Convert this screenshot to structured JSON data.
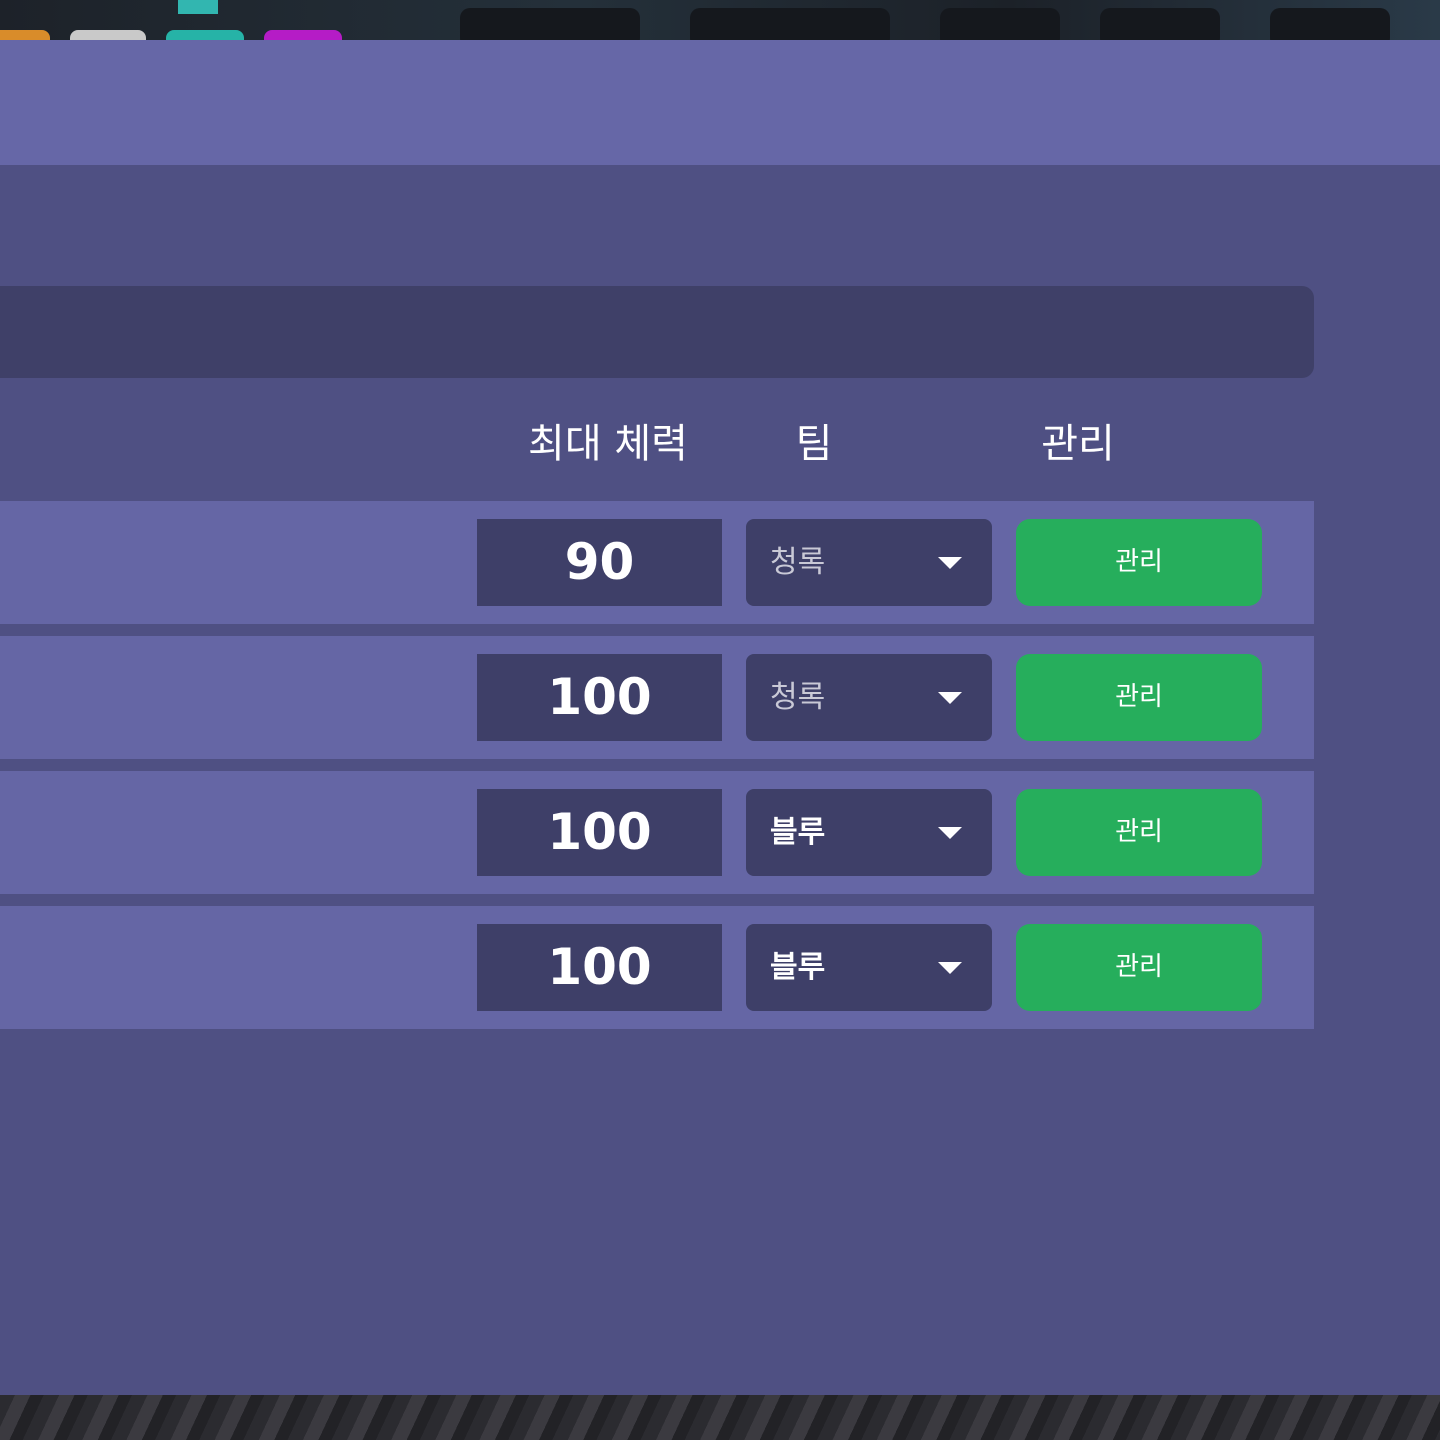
{
  "table": {
    "headers": {
      "max_hp": "최대 체력",
      "team": "팀",
      "manage": "관리"
    },
    "rows": [
      {
        "max_hp": "90",
        "team": "청록",
        "manage_label": "관리"
      },
      {
        "max_hp": "100",
        "team": "청록",
        "manage_label": "관리"
      },
      {
        "max_hp": "100",
        "team": "블루",
        "manage_label": "관리"
      },
      {
        "max_hp": "100",
        "team": "블루",
        "manage_label": "관리"
      }
    ]
  },
  "icons": {
    "dropdown": "caret-down-icon"
  },
  "colors": {
    "panel_bg": "#4f5083",
    "header_bg": "#6667a7",
    "row_bg": "#6566a5",
    "field_bg": "#3e3f68",
    "manage_button": "#26ae5c"
  }
}
